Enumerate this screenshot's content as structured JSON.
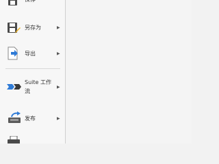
{
  "menu": {
    "items": [
      {
        "label": "保存"
      },
      {
        "label": "另存为"
      },
      {
        "label": "导出"
      },
      {
        "label": "Suite 工作",
        "label2": "流"
      },
      {
        "label": "发布"
      }
    ]
  },
  "icons": {
    "save": "floppy-disk-icon",
    "save_as": "floppy-disk-pencil-icon",
    "export": "export-arrow-icon",
    "suite": "suite-workflow-icon",
    "publish": "publish-tray-icon",
    "print": "printer-icon",
    "submenu": "chevron-right-icon"
  },
  "colors": {
    "accent_blue": "#2f7bd6",
    "menu_bg": "#f7f7f7",
    "content_bg": "#f4f4f4"
  }
}
